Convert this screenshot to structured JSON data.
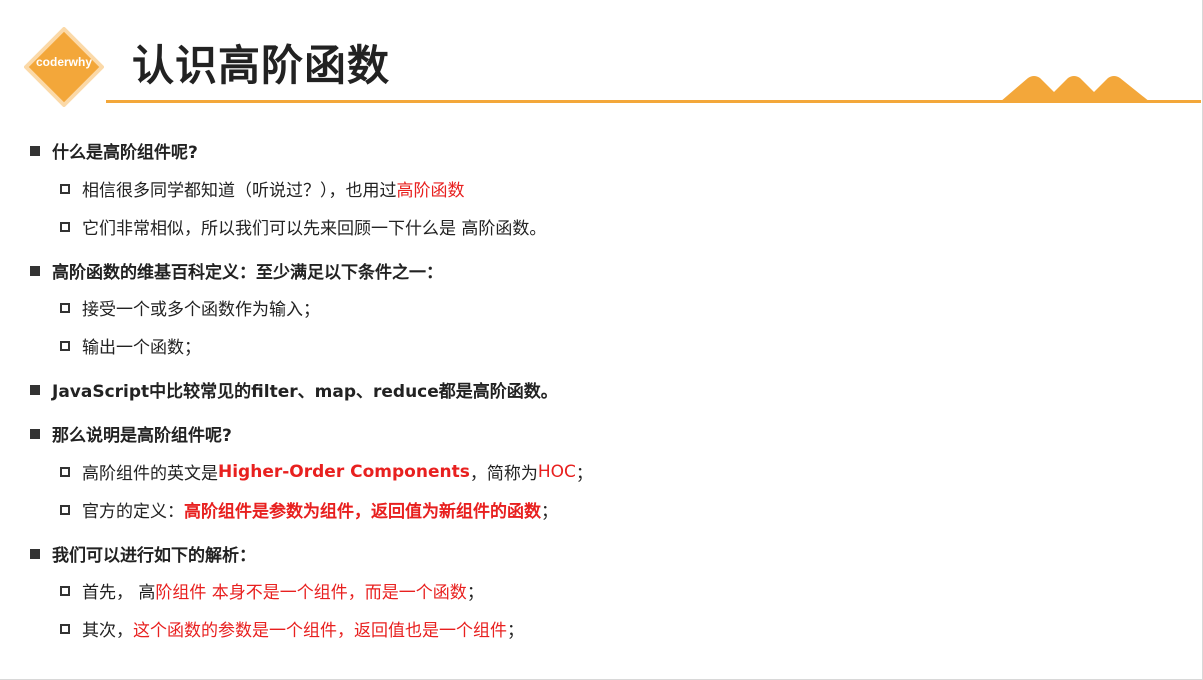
{
  "header": {
    "logo_text": "coderwhy",
    "title": "认识高阶函数"
  },
  "colors": {
    "accent": "#f3a73a",
    "emphasis": "#e8201f",
    "text": "#222222"
  },
  "bullets": {
    "b1": {
      "text": "什么是高阶组件呢?",
      "s1": {
        "a": "相信很多同学都知道（听说过？），也用过 ",
        "b": "高阶函数"
      },
      "s2": {
        "a": "它们非常相似，所以我们可以先来回顾一下什么是 高阶函数。"
      }
    },
    "b2": {
      "text": "高阶函数的维基百科定义：至少满足以下条件之一：",
      "s1": {
        "a": "接受一个或多个函数作为输入；"
      },
      "s2": {
        "a": "输出一个函数；"
      }
    },
    "b3": {
      "text": "JavaScript中比较常见的filter、map、reduce都是高阶函数。"
    },
    "b4": {
      "text": "那么说明是高阶组件呢?",
      "s1": {
        "a": "高阶组件的英文是 ",
        "b": "Higher-Order Components",
        "c": "，简称为 ",
        "d": "HOC",
        "e": "；"
      },
      "s2": {
        "a": "官方的定义：",
        "b": "高阶组件是参数为组件，返回值为新组件的函数",
        "c": "；"
      }
    },
    "b5": {
      "text": "我们可以进行如下的解析：",
      "s1": {
        "a": "首先， 高",
        "b": "阶组件 本身不是一个组件，而是一个函数",
        "c": "；"
      },
      "s2": {
        "a": "其次，",
        "b": "这个函数的参数是一个组件，返回值也是一个组件",
        "c": "；"
      }
    }
  }
}
